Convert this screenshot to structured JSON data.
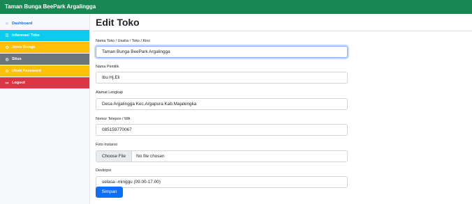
{
  "topbar": {
    "title": "Taman Bunga BeePark Argalingga"
  },
  "sidebar": {
    "items": [
      {
        "label": "Dashboard",
        "icon": "home-icon"
      },
      {
        "label": "Informasi Toko",
        "icon": "list-icon"
      },
      {
        "label": "Jenis Bunga",
        "icon": "flower-icon"
      },
      {
        "label": "Situs",
        "icon": "globe-icon"
      },
      {
        "label": "Ubah Password",
        "icon": "gear-icon"
      },
      {
        "label": "Logout",
        "icon": "logout-icon"
      }
    ]
  },
  "main": {
    "title": "Edit Toko",
    "form": {
      "nama_toko": {
        "label": "Nama Toko / Usaha / Toko / Kios",
        "value": "Taman Bunga BeePark Argalingga"
      },
      "nama_pemilik": {
        "label": "Nama Pemilik",
        "value": "Ibu Hj.Eli"
      },
      "alamat": {
        "label": "Alamat Lengkap",
        "value": "Desa Argalingga Kec.Argapura Kab.Majalengka"
      },
      "telepon": {
        "label": "Nomor Telepon / WA",
        "value": "085159770067"
      },
      "foto": {
        "label": "Foto Instansi",
        "button": "Choose File",
        "status": "No file chosen"
      },
      "deskripsi": {
        "label": "Deskripsi",
        "value": "selasa--minggu  (09.00-17.00)"
      }
    },
    "submit_label": "Simpan"
  },
  "colors": {
    "topbar": "#198754",
    "info": "#0dcaf0",
    "warning": "#ffc107",
    "secondary": "#6c757d",
    "danger": "#dc3545",
    "primary": "#0d6efd"
  }
}
